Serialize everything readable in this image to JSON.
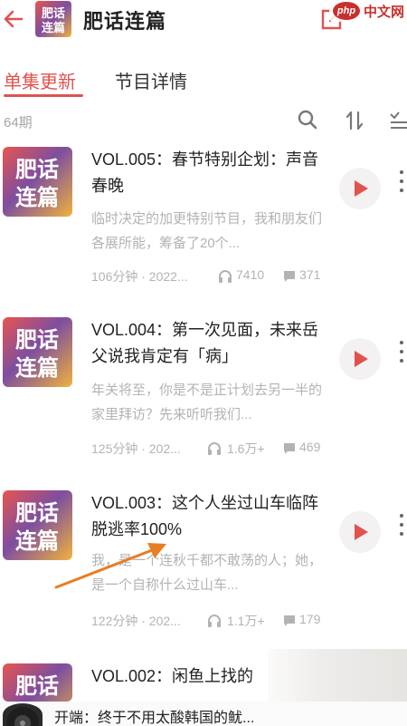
{
  "header": {
    "title": "肥话连篇",
    "watermark_badge": "php",
    "watermark_text": "中文网"
  },
  "tabs": [
    {
      "label": "单集更新",
      "active": true
    },
    {
      "label": "节目详情",
      "active": false
    }
  ],
  "list": {
    "count_label": "64期"
  },
  "cover_text": {
    "line1": "肥话",
    "line2": "连篇"
  },
  "episodes": [
    {
      "title": "VOL.005：春节特别企划：声音春晚",
      "description": "临时决定的加更特别节目，我和朋友们各展所能，筹备了20个...",
      "duration_date": "106分钟 · 2022...",
      "plays": "7410",
      "comments": "371"
    },
    {
      "title": "VOL.004：第一次见面，未来岳父说我肯定有「病」",
      "description": "年关将至，你是不是正计划去另一半的家里拜访？先来听听我们...",
      "duration_date": "125分钟 · 202...",
      "plays": "1.6万+",
      "comments": "469"
    },
    {
      "title": "VOL.003：这个人坐过山车临阵脱逃率100%",
      "description": "我，是一个连秋千都不敢荡的人；她，是一个自称什么过山车...",
      "duration_date": "122分钟 · 202...",
      "plays": "1.1万+",
      "comments": "179"
    },
    {
      "title": "VOL.002：闲鱼上找的",
      "description": "",
      "duration_date": "",
      "plays": "",
      "comments": ""
    }
  ],
  "mini_player": {
    "now_playing": "开端：终于不用太酸韩国的鱿..."
  },
  "colors": {
    "accent": "#e1524f",
    "muted_text": "#b3b3b3",
    "annotation_arrow": "#e67e22"
  },
  "icons": [
    "back-arrow-icon",
    "share-icon",
    "more-icon",
    "search-icon",
    "sort-icon",
    "batch-select-icon",
    "play-icon",
    "headphone-icon",
    "comment-icon",
    "more-vertical-icon"
  ]
}
